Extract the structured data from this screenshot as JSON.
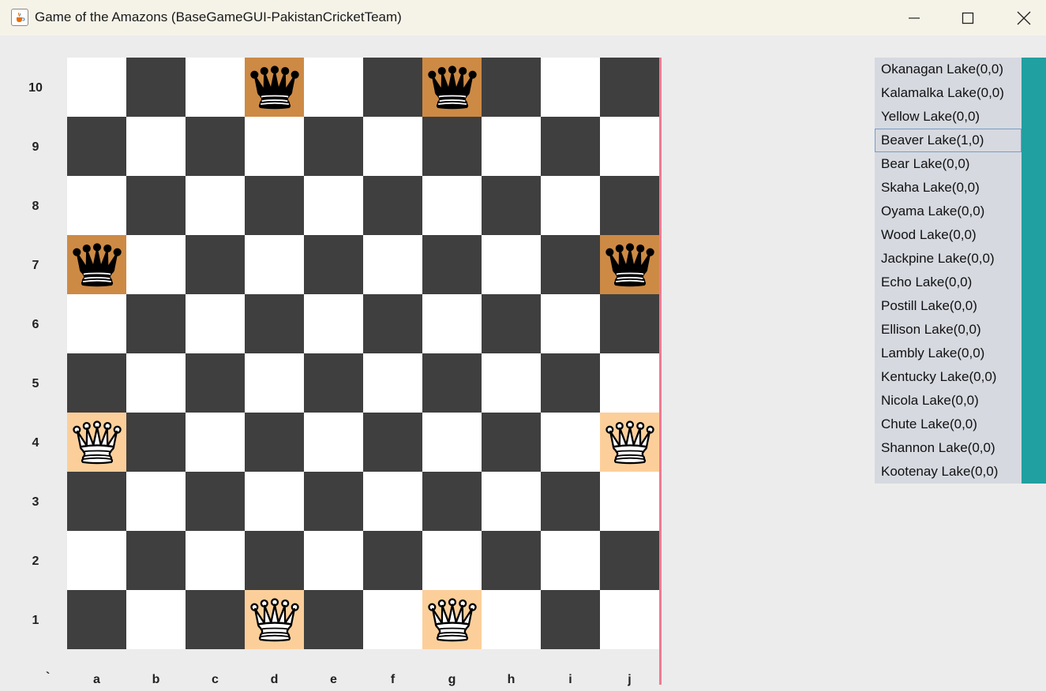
{
  "window": {
    "title": "Game of the Amazons (BaseGameGUI-PakistanCricketTeam)",
    "app_icon": "java-cup-icon",
    "controls": [
      "minimize-icon",
      "maximize-icon",
      "close-icon"
    ]
  },
  "board": {
    "size": 10,
    "ranks": [
      "10",
      "9",
      "8",
      "7",
      "6",
      "5",
      "4",
      "3",
      "2",
      "1"
    ],
    "files": [
      "a",
      "b",
      "c",
      "d",
      "e",
      "f",
      "g",
      "h",
      "i",
      "j"
    ],
    "corner_label": "`",
    "colors": {
      "light": "#ffffff",
      "dark": "#3f3f3f",
      "black_queen_square": "#cd8a45",
      "white_queen_square": "#fccf9a",
      "edge_line": "#ee7a92"
    },
    "pieces": [
      {
        "square": "d10",
        "color": "black",
        "type": "queen"
      },
      {
        "square": "g10",
        "color": "black",
        "type": "queen"
      },
      {
        "square": "a7",
        "color": "black",
        "type": "queen"
      },
      {
        "square": "j7",
        "color": "black",
        "type": "queen"
      },
      {
        "square": "a4",
        "color": "white",
        "type": "queen"
      },
      {
        "square": "j4",
        "color": "white",
        "type": "queen"
      },
      {
        "square": "d1",
        "color": "white",
        "type": "queen"
      },
      {
        "square": "g1",
        "color": "white",
        "type": "queen"
      }
    ]
  },
  "player_list": {
    "selected_index": 3,
    "background": "#d6d9e0",
    "scrollbar_color": "#20a0a0",
    "items": [
      "Okanagan Lake(0,0)",
      "Kalamalka Lake(0,0)",
      "Yellow Lake(0,0)",
      "Beaver Lake(1,0)",
      "Bear Lake(0,0)",
      "Skaha Lake(0,0)",
      "Oyama Lake(0,0)",
      "Wood Lake(0,0)",
      "Jackpine Lake(0,0)",
      "Echo Lake(0,0)",
      "Postill Lake(0,0)",
      "Ellison Lake(0,0)",
      "Lambly Lake(0,0)",
      "Kentucky Lake(0,0)",
      "Nicola Lake(0,0)",
      "Chute Lake(0,0)",
      "Shannon Lake(0,0)",
      "Kootenay Lake(0,0)"
    ]
  }
}
